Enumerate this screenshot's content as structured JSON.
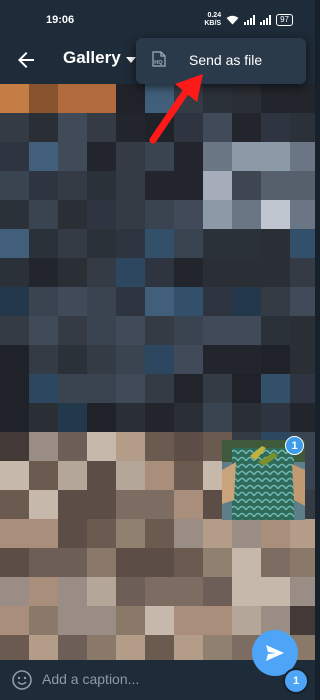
{
  "statusbar": {
    "time": "19:06",
    "net_speed_value": "0.24",
    "net_speed_unit": "KB/S",
    "battery": "97"
  },
  "appbar": {
    "title": "Gallery"
  },
  "menu": {
    "items": [
      {
        "label": "Send as file",
        "icon": "hq-file-icon"
      }
    ]
  },
  "selection": {
    "badge_number": "1"
  },
  "caption": {
    "placeholder": "Add a caption..."
  },
  "send": {
    "count": "1"
  },
  "colors": {
    "background": "#17212b",
    "bar": "#1e2b38",
    "accent": "#4ea4f6",
    "badge": "#3d9be9",
    "arrow": "#ff1a1a"
  }
}
